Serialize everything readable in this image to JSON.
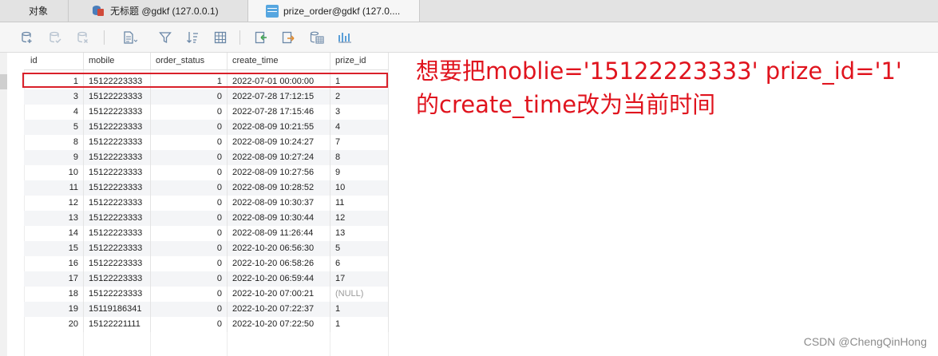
{
  "tabs": [
    {
      "label": "对象",
      "icon": "none"
    },
    {
      "label": "无标题 @gdkf (127.0.0.1)",
      "icon": "database-query-icon"
    },
    {
      "label": "prize_order@gdkf (127.0....",
      "icon": "table-grid-icon"
    }
  ],
  "toolbar": {
    "buttons": [
      "add-record-icon",
      "save-record-icon",
      "delete-record-icon",
      "text-view-icon",
      "filter-icon",
      "sort-icon",
      "grid-view-icon",
      "import-icon",
      "export-icon",
      "data-generate-icon",
      "chart-icon"
    ]
  },
  "table": {
    "columns": [
      "id",
      "mobile",
      "order_status",
      "create_time",
      "prize_id"
    ],
    "rows": [
      [
        "1",
        "15122223333",
        "1",
        "2022-07-01 00:00:00",
        "1"
      ],
      [
        "3",
        "15122223333",
        "0",
        "2022-07-28 17:12:15",
        "2"
      ],
      [
        "4",
        "15122223333",
        "0",
        "2022-07-28 17:15:46",
        "3"
      ],
      [
        "5",
        "15122223333",
        "0",
        "2022-08-09 10:21:55",
        "4"
      ],
      [
        "8",
        "15122223333",
        "0",
        "2022-08-09 10:24:27",
        "7"
      ],
      [
        "9",
        "15122223333",
        "0",
        "2022-08-09 10:27:24",
        "8"
      ],
      [
        "10",
        "15122223333",
        "0",
        "2022-08-09 10:27:56",
        "9"
      ],
      [
        "11",
        "15122223333",
        "0",
        "2022-08-09 10:28:52",
        "10"
      ],
      [
        "12",
        "15122223333",
        "0",
        "2022-08-09 10:30:37",
        "11"
      ],
      [
        "13",
        "15122223333",
        "0",
        "2022-08-09 10:30:44",
        "12"
      ],
      [
        "14",
        "15122223333",
        "0",
        "2022-08-09 11:26:44",
        "13"
      ],
      [
        "15",
        "15122223333",
        "0",
        "2022-10-20 06:56:30",
        "5"
      ],
      [
        "16",
        "15122223333",
        "0",
        "2022-10-20 06:58:26",
        "6"
      ],
      [
        "17",
        "15122223333",
        "0",
        "2022-10-20 06:59:44",
        "17"
      ],
      [
        "18",
        "15122223333",
        "0",
        "2022-10-20 07:00:21",
        "(NULL)"
      ],
      [
        "19",
        "15119186341",
        "0",
        "2022-10-20 07:22:37",
        "1"
      ],
      [
        "20",
        "15122221111",
        "0",
        "2022-10-20 07:22:50",
        "1"
      ]
    ]
  },
  "annotation": {
    "line1": "想要把moblie='15122223333' prize_id='1'",
    "line2": "的create_time改为当前时间",
    "color": "#e0141e"
  },
  "watermark": "CSDN @ChengQinHong"
}
